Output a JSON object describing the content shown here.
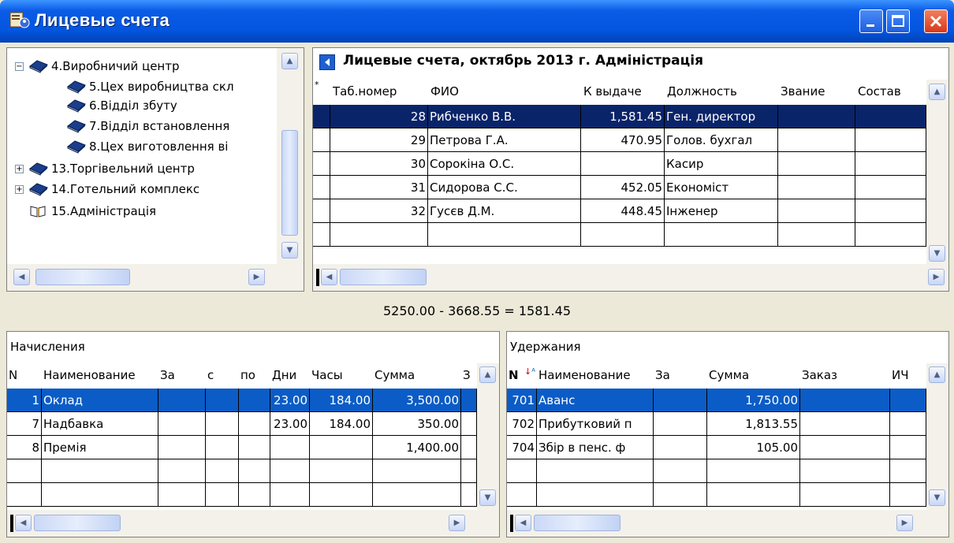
{
  "window": {
    "title": "Лицевые счета"
  },
  "tree": {
    "items": [
      {
        "label": "4.Виробничий центр",
        "expander": "−"
      },
      {
        "label": "5.Цех виробництва скл"
      },
      {
        "label": "6.Відділ збуту"
      },
      {
        "label": "7.Відділ встановлення"
      },
      {
        "label": "8.Цех виготовлення ві"
      },
      {
        "label": "13.Торгівельний центр",
        "expander": "+"
      },
      {
        "label": "14.Готельний комплекс",
        "expander": "+"
      },
      {
        "label": "15.Адміністрація"
      }
    ]
  },
  "accounts": {
    "title": "Лицевые счета, октябрь 2013 г. Адміністрація",
    "columns": [
      "Таб.номер",
      "ФИО",
      "К выдаче",
      "Должность",
      "Звание",
      "Состав"
    ],
    "rows": [
      {
        "tab": "28",
        "fio": "Рибченко В.В.",
        "pay": "1,581.45",
        "pos": "Ген. директор"
      },
      {
        "tab": "29",
        "fio": "Петрова Г.А.",
        "pay": "470.95",
        "pos": "Голов. бухгал"
      },
      {
        "tab": "30",
        "fio": "Сорокіна О.С.",
        "pay": "",
        "pos": "Касир"
      },
      {
        "tab": "31",
        "fio": "Сидорова С.С.",
        "pay": "452.05",
        "pos": "Економіст"
      },
      {
        "tab": "32",
        "fio": "Гусєв Д.М.",
        "pay": "448.45",
        "pos": "Інженер"
      }
    ]
  },
  "summary": {
    "formula": "5250.00 - 3668.55 = 1581.45"
  },
  "accruals": {
    "title": "Начисления",
    "columns": [
      "N",
      "Наименование",
      "За",
      "с",
      "по",
      "Дни",
      "Часы",
      "Сумма",
      "З"
    ],
    "rows": [
      {
        "n": "1",
        "name": "Оклад",
        "days": "23.00",
        "hours": "184.00",
        "sum": "3,500.00"
      },
      {
        "n": "7",
        "name": "Надбавка",
        "days": "23.00",
        "hours": "184.00",
        "sum": "350.00"
      },
      {
        "n": "8",
        "name": "Премія",
        "days": "",
        "hours": "",
        "sum": "1,400.00"
      }
    ]
  },
  "deductions": {
    "title": "Удержания",
    "columns": [
      "N",
      "Наименование",
      "За",
      "Сумма",
      "Заказ",
      "ИЧ"
    ],
    "rows": [
      {
        "n": "701",
        "name": "Аванс",
        "sum": "1,750.00"
      },
      {
        "n": "702",
        "name": "Прибутковий п",
        "sum": "1,813.55"
      },
      {
        "n": "704",
        "name": "Збір в пенс. ф",
        "sum": "105.00"
      }
    ]
  }
}
